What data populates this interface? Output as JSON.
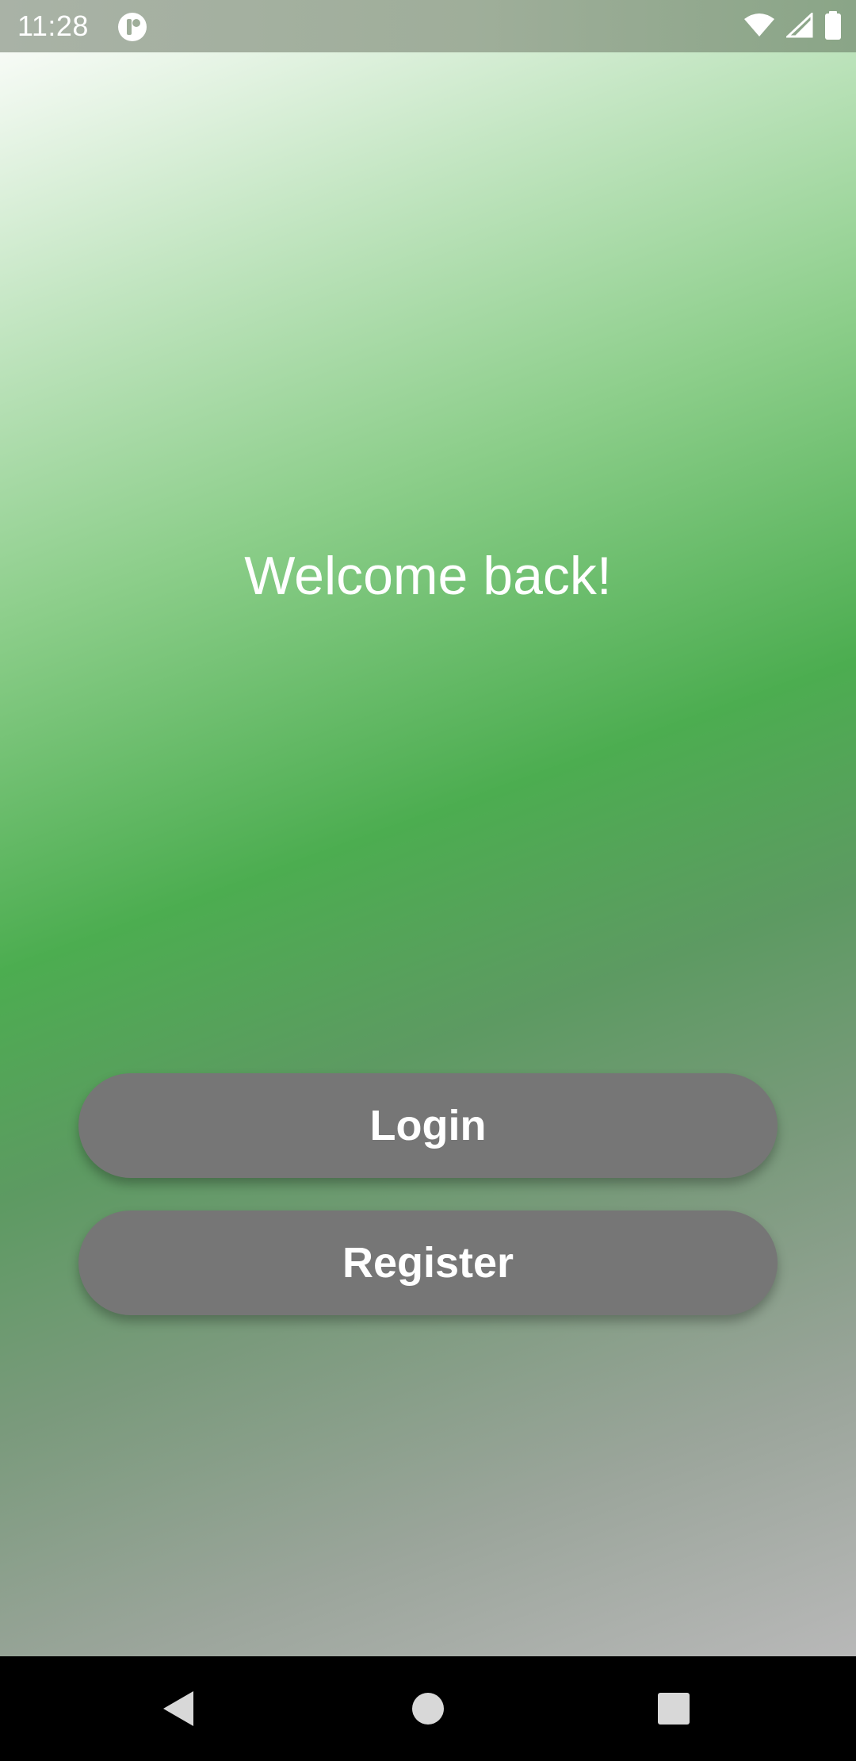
{
  "status_bar": {
    "time": "11:28",
    "app_icon": "notification-app-icon",
    "wifi_icon": "wifi-icon",
    "signal_icon": "cell-signal-icon",
    "battery_icon": "battery-icon"
  },
  "main": {
    "welcome_text": "Welcome back!",
    "login_label": "Login",
    "register_label": "Register"
  },
  "nav_bar": {
    "back_icon": "back-triangle-icon",
    "home_icon": "home-circle-icon",
    "recents_icon": "recents-square-icon"
  },
  "colors": {
    "button_bg": "#767676",
    "gradient_top": "#f7fbf6",
    "gradient_mid": "#4cad50",
    "gradient_bottom": "#b8b8b8",
    "nav_bg": "#000000"
  }
}
